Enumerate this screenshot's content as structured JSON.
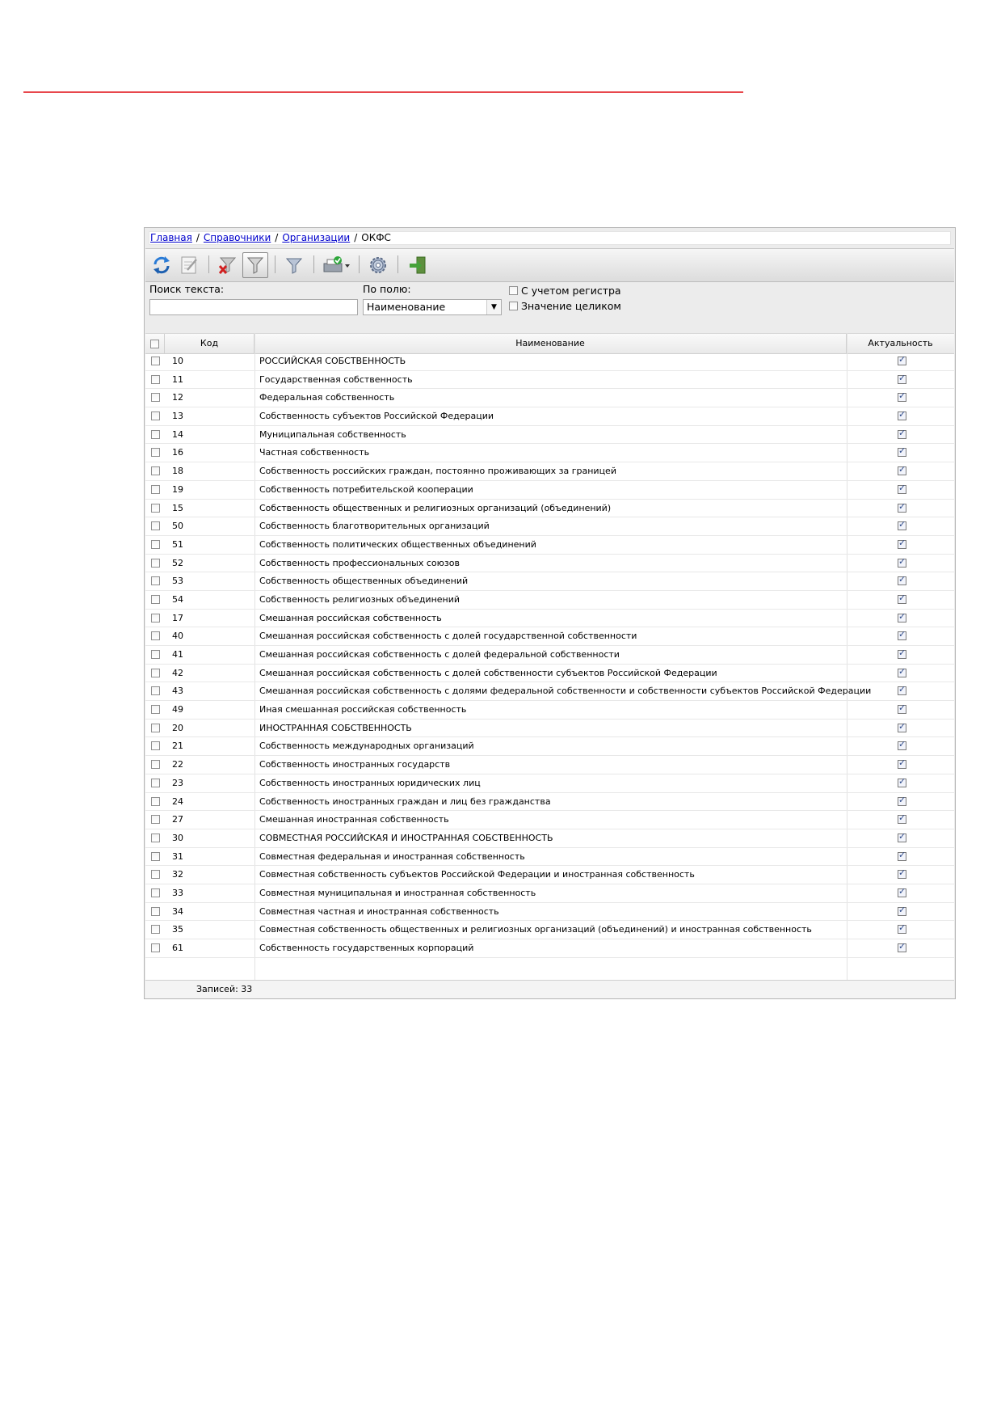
{
  "colors": {
    "accent_line": "#e8474c",
    "link": "#0000cc"
  },
  "breadcrumb": {
    "items": [
      "Главная",
      "Справочники",
      "Организации"
    ],
    "current": "ОКФС",
    "separator": "/"
  },
  "toolbar": {
    "icons": [
      "refresh-icon",
      "edit-icon",
      "clear-filter-icon",
      "filter-icon",
      "funnel-icon",
      "print-icon",
      "settings-icon",
      "exit-icon"
    ]
  },
  "search": {
    "text_label": "Поиск текста:",
    "text_value": "",
    "field_label": "По полю:",
    "field_value": "Наименование",
    "case_label": "С учетом регистра",
    "whole_label": "Значение целиком"
  },
  "grid": {
    "headers": {
      "code": "Код",
      "name": "Наименование",
      "actual": "Актуальность"
    },
    "rows": [
      {
        "code": "10",
        "name": "РОССИЙСКАЯ СОБСТВЕННОСТЬ",
        "actual": true
      },
      {
        "code": "11",
        "name": "Государственная собственность",
        "actual": true
      },
      {
        "code": "12",
        "name": "Федеральная собственность",
        "actual": true
      },
      {
        "code": "13",
        "name": "Собственность субъектов Российской Федерации",
        "actual": true
      },
      {
        "code": "14",
        "name": "Муниципальная собственность",
        "actual": true
      },
      {
        "code": "16",
        "name": "Частная собственность",
        "actual": true
      },
      {
        "code": "18",
        "name": "Собственность российских граждан, постоянно проживающих за границей",
        "actual": true
      },
      {
        "code": "19",
        "name": "Собственность потребительской кооперации",
        "actual": true
      },
      {
        "code": "15",
        "name": "Собственность общественных и религиозных организаций (объединений)",
        "actual": true
      },
      {
        "code": "50",
        "name": "Собственность благотворительных организаций",
        "actual": true
      },
      {
        "code": "51",
        "name": "Собственность политических общественных объединений",
        "actual": true
      },
      {
        "code": "52",
        "name": "Собственность профессиональных союзов",
        "actual": true
      },
      {
        "code": "53",
        "name": "Собственность общественных объединений",
        "actual": true
      },
      {
        "code": "54",
        "name": "Собственность религиозных объединений",
        "actual": true
      },
      {
        "code": "17",
        "name": "Смешанная российская собственность",
        "actual": true
      },
      {
        "code": "40",
        "name": "Смешанная российская собственность с долей государственной собственности",
        "actual": true
      },
      {
        "code": "41",
        "name": "Смешанная российская собственность с долей федеральной собственности",
        "actual": true
      },
      {
        "code": "42",
        "name": "Смешанная российская собственность с долей собственности субъектов Российской Федерации",
        "actual": true
      },
      {
        "code": "43",
        "name": "Смешанная российская собственность с долями федеральной собственности и собственности субъектов Российской Федерации",
        "actual": true
      },
      {
        "code": "49",
        "name": "Иная смешанная российская собственность",
        "actual": true
      },
      {
        "code": "20",
        "name": "ИНОСТРАННАЯ СОБСТВЕННОСТЬ",
        "actual": true
      },
      {
        "code": "21",
        "name": "Собственность международных организаций",
        "actual": true
      },
      {
        "code": "22",
        "name": "Собственность иностранных государств",
        "actual": true
      },
      {
        "code": "23",
        "name": "Собственность иностранных юридических лиц",
        "actual": true
      },
      {
        "code": "24",
        "name": "Собственность иностранных граждан и лиц без гражданства",
        "actual": true
      },
      {
        "code": "27",
        "name": "Смешанная иностранная собственность",
        "actual": true
      },
      {
        "code": "30",
        "name": "СОВМЕСТНАЯ РОССИЙСКАЯ И ИНОСТРАННАЯ СОБСТВЕННОСТЬ",
        "actual": true
      },
      {
        "code": "31",
        "name": "Совместная федеральная и иностранная собственность",
        "actual": true
      },
      {
        "code": "32",
        "name": "Совместная собственность субъектов Российской Федерации и иностранная собственность",
        "actual": true
      },
      {
        "code": "33",
        "name": "Совместная муниципальная и иностранная собственность",
        "actual": true
      },
      {
        "code": "34",
        "name": "Совместная частная и иностранная собственность",
        "actual": true
      },
      {
        "code": "35",
        "name": "Совместная собственность общественных и религиозных организаций (объединений) и иностранная собственность",
        "actual": true
      },
      {
        "code": "61",
        "name": "Собственность государственных корпораций",
        "actual": true
      }
    ],
    "footer": "Записей: 33"
  }
}
